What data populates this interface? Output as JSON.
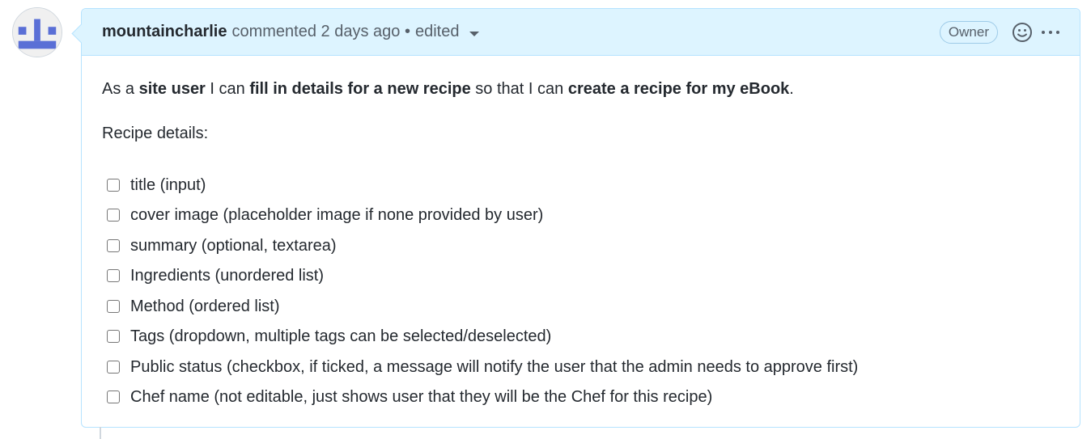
{
  "comment": {
    "author": "mountaincharlie",
    "action": "commented",
    "time": "2 days ago",
    "separator": "•",
    "edited_label": "edited",
    "badge": "Owner",
    "icons": {
      "reaction": "smiley-icon",
      "more": "kebab-horizontal-icon",
      "edited_dropdown": "triangle-down-icon"
    }
  },
  "body": {
    "intro": {
      "t1": "As a ",
      "b1": "site user",
      "t2": " I can ",
      "b2": "fill in details for a new recipe",
      "t3": " so that I can ",
      "b3": "create a recipe for my eBook",
      "t4": "."
    },
    "details_heading": "Recipe details:",
    "tasks": [
      {
        "label": "title (input)",
        "checked": false
      },
      {
        "label": "cover image (placeholder image if none provided by user)",
        "checked": false
      },
      {
        "label": "summary (optional, textarea)",
        "checked": false
      },
      {
        "label": "Ingredients (unordered list)",
        "checked": false
      },
      {
        "label": "Method (ordered list)",
        "checked": false
      },
      {
        "label": "Tags (dropdown, multiple tags can be selected/deselected)",
        "checked": false
      },
      {
        "label": "Public status (checkbox, if ticked, a message will notify the user that the admin needs to approve first)",
        "checked": false
      },
      {
        "label": "Chef name (not editable, just shows user that they will be the Chef for this recipe)",
        "checked": false
      }
    ]
  },
  "colors": {
    "header_bg": "#ddf4ff",
    "border": "#b6e3ff",
    "avatar_identicon": "#5a6fd6",
    "text": "#24292f",
    "muted": "#57606a"
  }
}
